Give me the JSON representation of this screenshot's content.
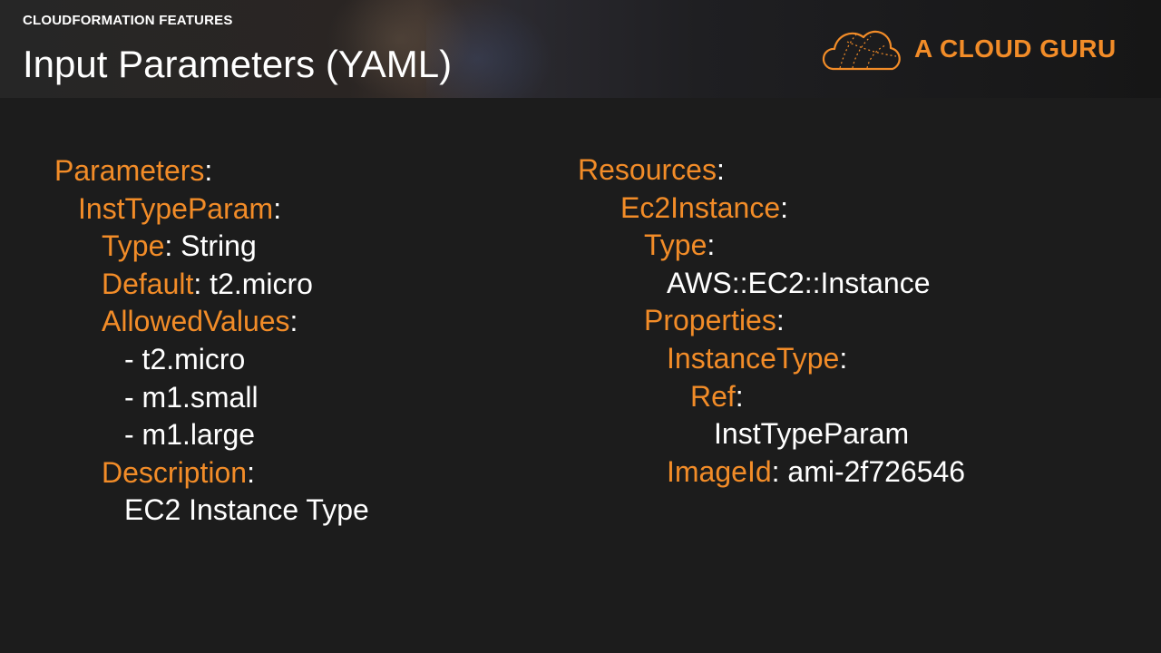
{
  "header": {
    "eyebrow": "CLOUDFORMATION FEATURES",
    "title": "Input Parameters (YAML)",
    "brand": "A CLOUD GURU",
    "logo_icon": "cloud-icon"
  },
  "colors": {
    "key": "#f28c28",
    "value": "#ffffff",
    "background": "#1c1c1c"
  },
  "left_code": {
    "parameters_key": "Parameters",
    "inst_type_param_key": "InstTypeParam",
    "type_key": "Type",
    "type_value": "String",
    "default_key": "Default",
    "default_value": "t2.micro",
    "allowed_values_key": "AllowedValues",
    "allowed_values": [
      "- t2.micro",
      "- m1.small",
      "- m1.large"
    ],
    "description_key": "Description",
    "description_value": "EC2 Instance Type"
  },
  "right_code": {
    "resources_key": "Resources",
    "ec2_instance_key": "Ec2Instance",
    "type_key": "Type",
    "type_value": "AWS::EC2::Instance",
    "properties_key": "Properties",
    "instance_type_key": "InstanceType",
    "ref_key": "Ref",
    "ref_value": "InstTypeParam",
    "image_id_key": "ImageId",
    "image_id_value": "ami-2f726546"
  }
}
